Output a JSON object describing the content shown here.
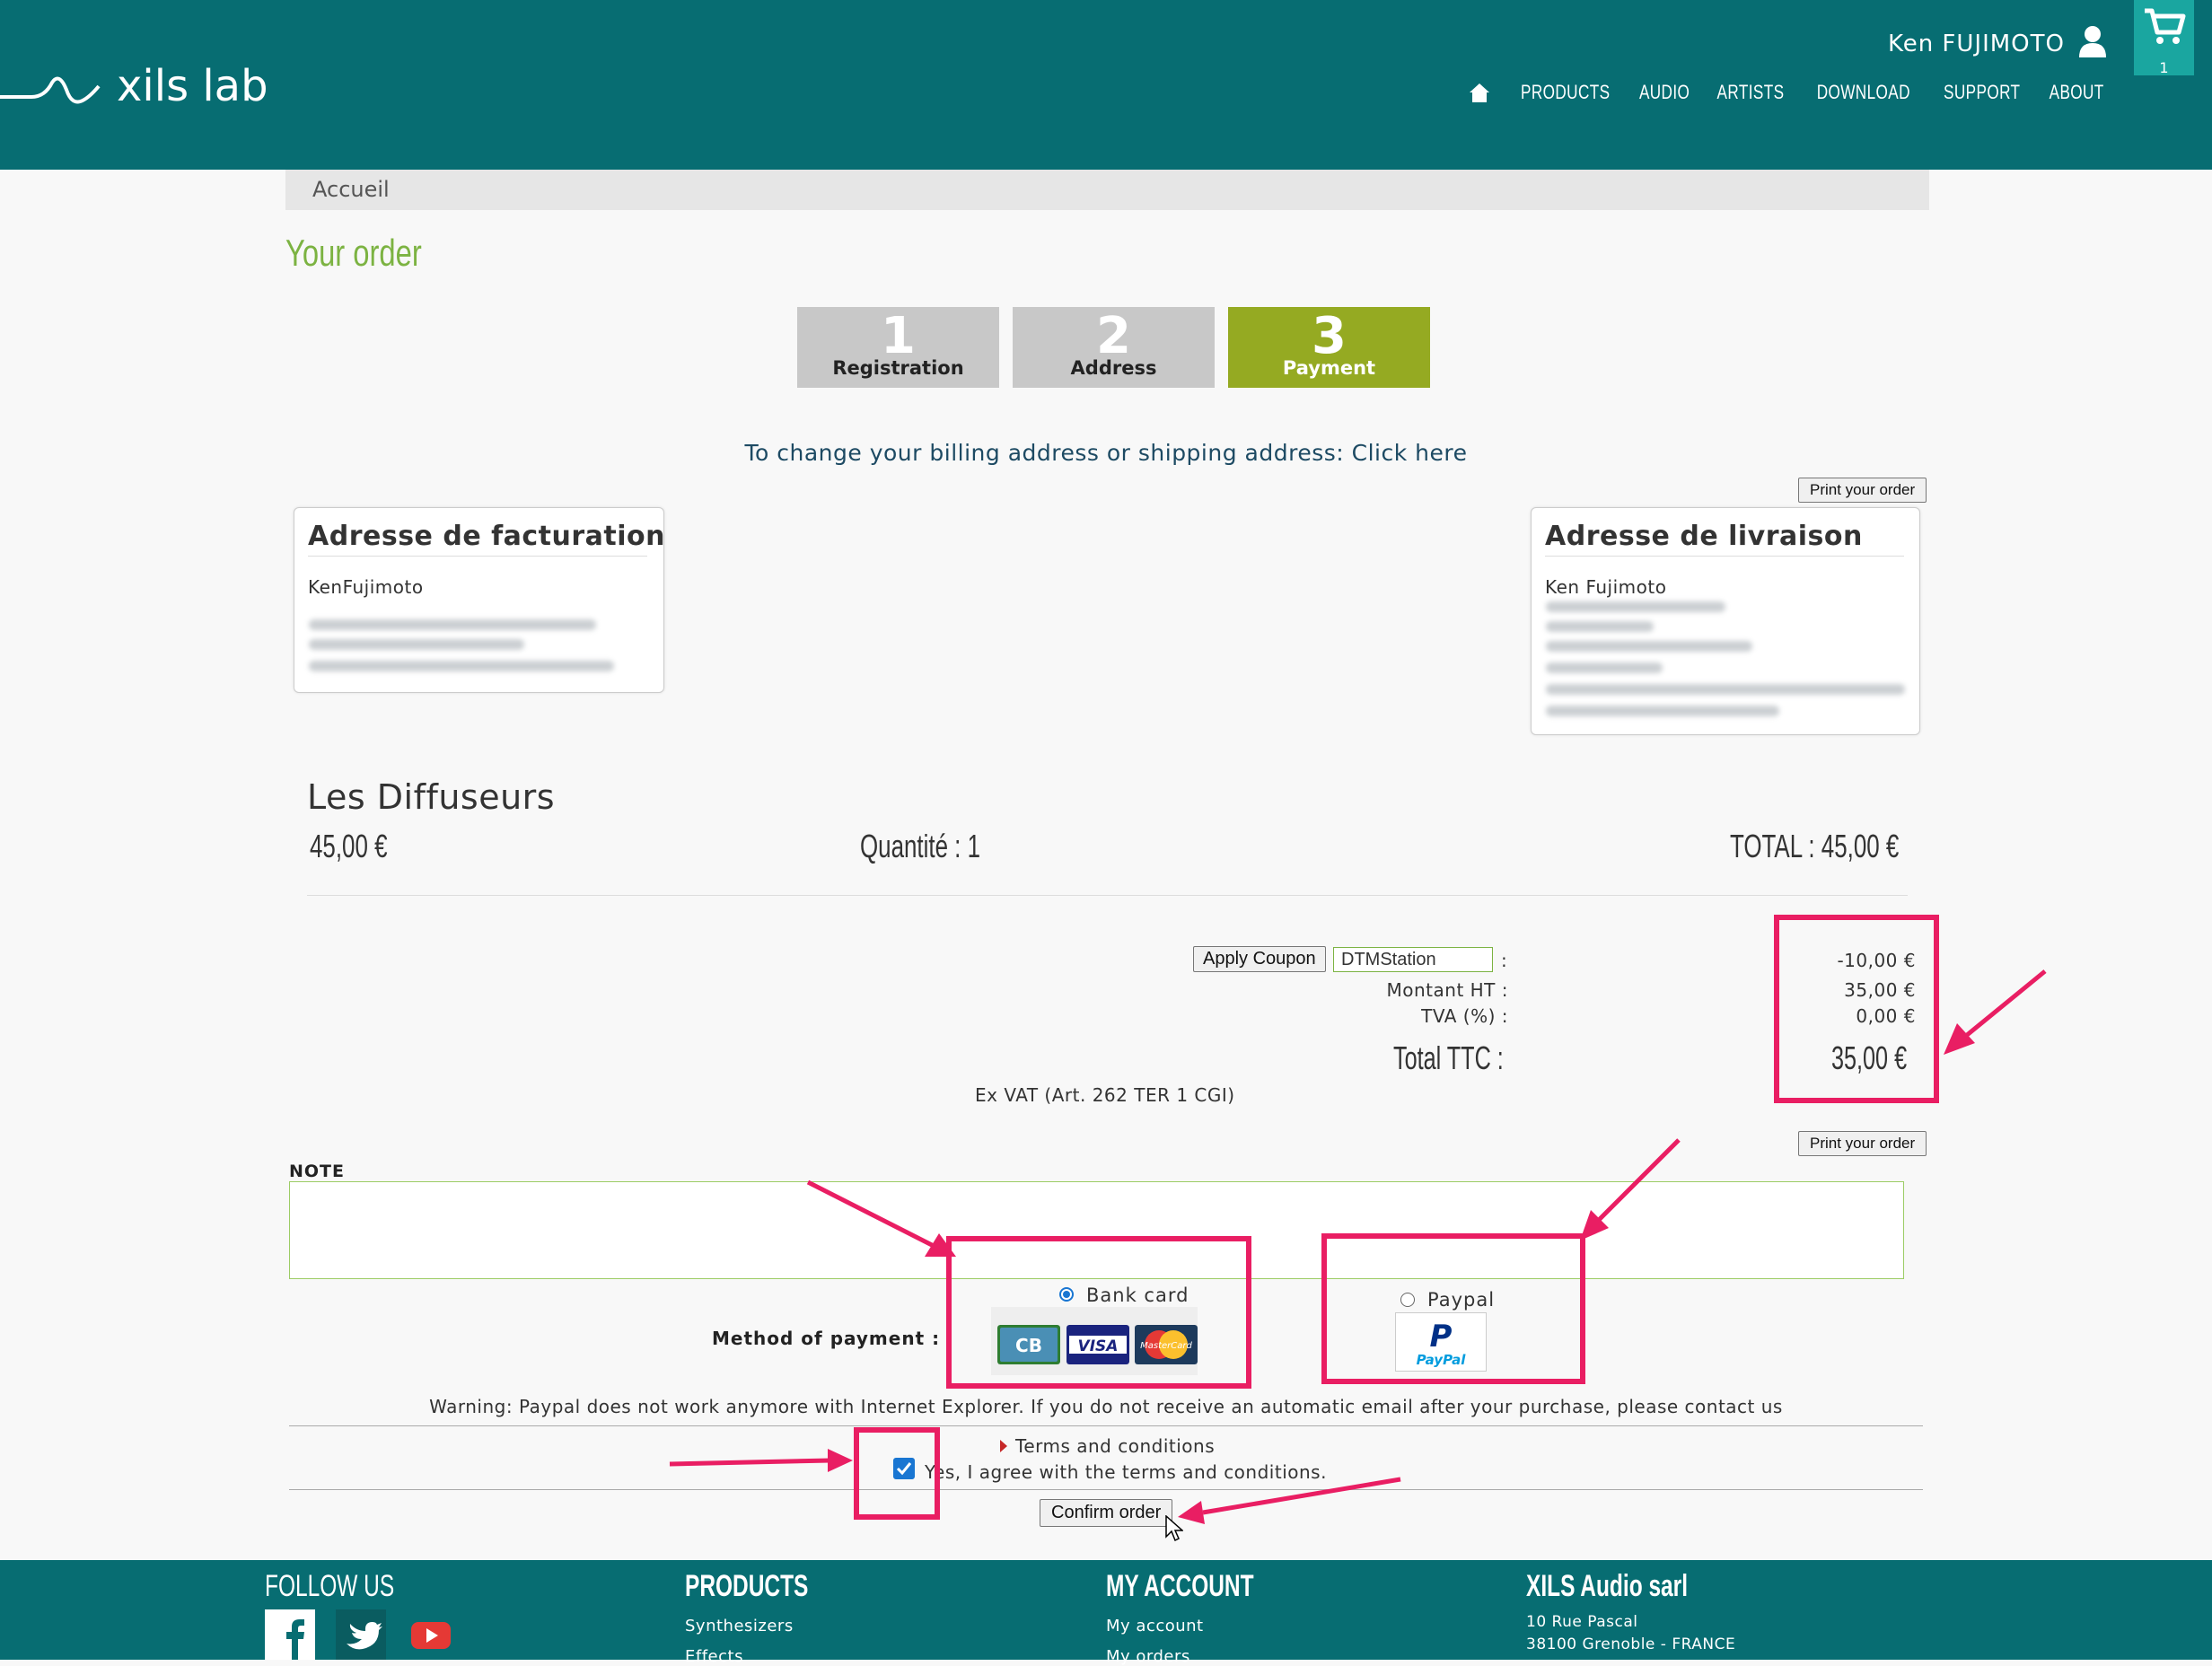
{
  "header": {
    "logo_text": "xils lab",
    "user_name": "Ken FUJIMOTO",
    "cart_count": "1",
    "nav": [
      "PRODUCTS",
      "AUDIO",
      "ARTISTS",
      "DOWNLOAD",
      "SUPPORT",
      "ABOUT"
    ]
  },
  "breadcrumb": "Accueil",
  "page_title": "Your order",
  "steps": [
    {
      "number": "1",
      "label": "Registration",
      "active": false
    },
    {
      "number": "2",
      "label": "Address",
      "active": false
    },
    {
      "number": "3",
      "label": "Payment",
      "active": true
    }
  ],
  "change_address_text": "To change your billing address or shipping address: Click here",
  "print_button": "Print your order",
  "billing": {
    "title": "Adresse de facturation",
    "name": "KenFujimoto"
  },
  "shipping": {
    "title": "Adresse de livraison",
    "name": "Ken Fujimoto"
  },
  "product": {
    "name": "Les Diffuseurs",
    "price": "45,00 €",
    "quantity": "Quantité : 1",
    "total": "TOTAL : 45,00 €"
  },
  "summary": {
    "apply_coupon": "Apply Coupon",
    "coupon_code": "DTMStation",
    "coupon_colon": ":",
    "coupon_value": "-10,00 €",
    "ht_label": "Montant HT :",
    "ht_value": "35,00 €",
    "tva_label": "TVA (%) :",
    "tva_value": "0,00 €",
    "ttc_label": "Total TTC :",
    "ttc_value": "35,00 €",
    "ex_vat": "Ex VAT (Art. 262 TER 1 CGI)"
  },
  "note_label": "NOTE",
  "payment": {
    "label": "Method of payment :",
    "bank_card": "Bank card",
    "bank_card_selected": true,
    "card_logos": [
      "CB",
      "VISA",
      "MasterCard"
    ],
    "paypal": "Paypal",
    "paypal_logo": "PayPal",
    "paypal_selected": false
  },
  "warning": "Warning: Paypal does not work anymore with Internet Explorer. If you do not receive an automatic email after your purchase, please contact us",
  "terms_link": "Terms and conditions",
  "agree_text": "Yes, I agree with the terms and conditions.",
  "agree_checked": true,
  "confirm_button": "Confirm order",
  "footer": {
    "follow_us": "FOLLOW US",
    "products_heading": "PRODUCTS",
    "products_links": [
      "Synthesizers",
      "Effects"
    ],
    "account_heading": "MY ACCOUNT",
    "account_links": [
      "My account",
      "My orders"
    ],
    "company_heading": "XILS Audio sarl",
    "company_address": [
      "10 Rue Pascal",
      "38100 Grenoble - FRANCE"
    ]
  },
  "colors": {
    "header_bg": "#076d72",
    "accent_green": "#95aa22",
    "title_green": "#7cb342",
    "annotation_pink": "#e91e63"
  }
}
